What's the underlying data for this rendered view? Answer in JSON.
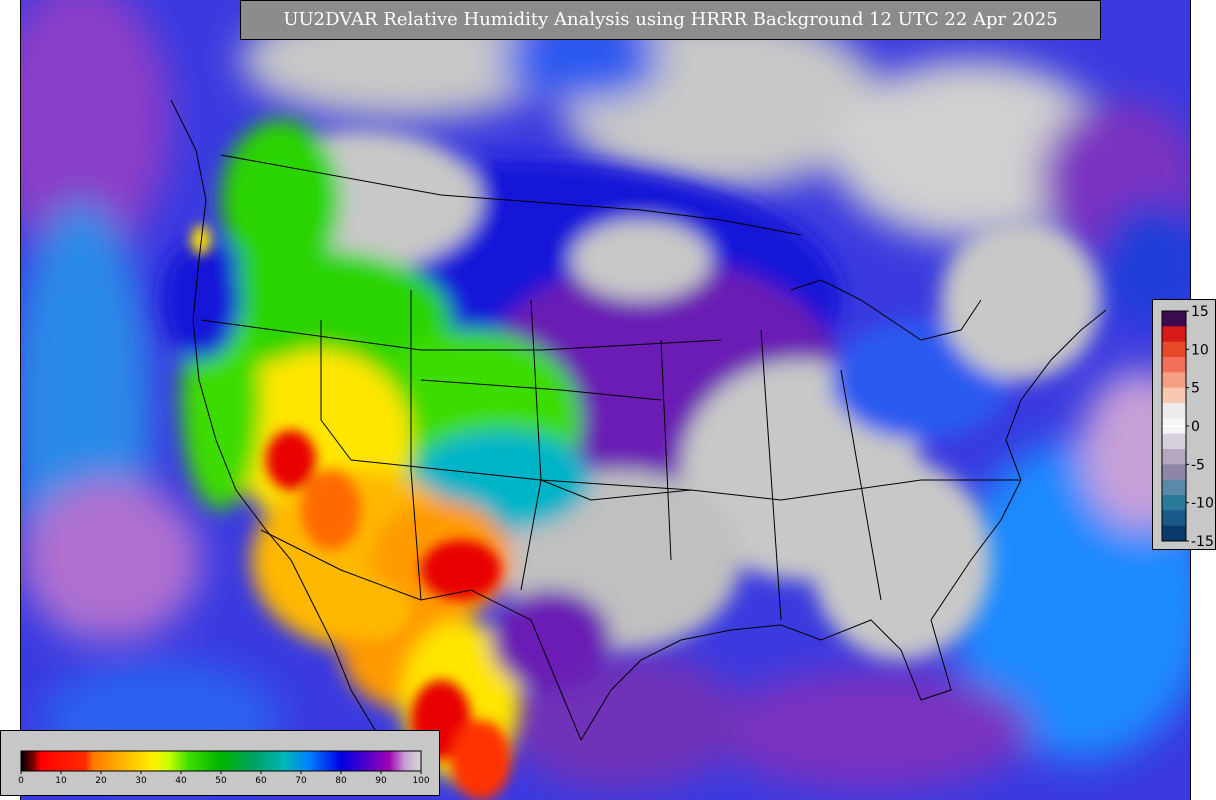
{
  "title": "UU2DVAR Relative Humidity Analysis using HRRR Background 12 UTC 22 Apr 2025",
  "bias_colorbar": {
    "labels": [
      "15",
      "10",
      "5",
      "0",
      "-5",
      "-10",
      "-15"
    ],
    "colors": [
      "#3d0a4f",
      "#d71a1a",
      "#e64a2a",
      "#f0705a",
      "#f5a085",
      "#f8c8b0",
      "#ebebeb",
      "#f5f5f5",
      "#d5d0dc",
      "#b5a8c0",
      "#8f86a8",
      "#5a8aa8",
      "#2a7a9a",
      "#1a5a8a",
      "#0a3a6a"
    ]
  },
  "rh_colorbar": {
    "labels": [
      "0",
      "10",
      "20",
      "30",
      "40",
      "50",
      "60",
      "70",
      "80",
      "90",
      "100"
    ],
    "stops": [
      {
        "v": 0,
        "c": "#000000"
      },
      {
        "v": 3,
        "c": "#7a0000"
      },
      {
        "v": 5,
        "c": "#ff0000"
      },
      {
        "v": 16,
        "c": "#ff2a00"
      },
      {
        "v": 18,
        "c": "#ff7a00"
      },
      {
        "v": 26,
        "c": "#ffb800"
      },
      {
        "v": 33,
        "c": "#ffef00"
      },
      {
        "v": 37,
        "c": "#c8ff00"
      },
      {
        "v": 42,
        "c": "#3cdc00"
      },
      {
        "v": 50,
        "c": "#00b400"
      },
      {
        "v": 58,
        "c": "#00a060"
      },
      {
        "v": 66,
        "c": "#00b8b8"
      },
      {
        "v": 72,
        "c": "#0080ff"
      },
      {
        "v": 80,
        "c": "#0000e6"
      },
      {
        "v": 87,
        "c": "#5a00c8"
      },
      {
        "v": 92,
        "c": "#a000b4"
      },
      {
        "v": 96,
        "c": "#c8a0d2"
      },
      {
        "v": 100,
        "c": "#d8d8d8"
      }
    ]
  },
  "colors": {
    "very_dry": "#e80000",
    "dry": "#ff9a00",
    "moderate": "#ffe600",
    "semi_moist": "#2ad400",
    "moist_green": "#00a87a",
    "teal": "#00b4c8",
    "blue": "#0050ff",
    "dark_blue": "#1818d8",
    "purple": "#6a1ab4",
    "magenta": "#9a20b0",
    "saturated": "#c8c8c8",
    "ocean_violet": "#8a3cc8",
    "boundary": "#000000"
  }
}
